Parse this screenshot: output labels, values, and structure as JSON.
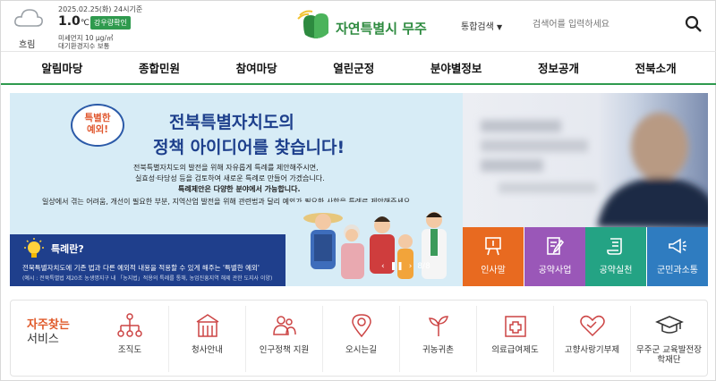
{
  "weather": {
    "icon": "cloud-icon",
    "condition": "흐림",
    "date": "2025.02.25(화) 24시기준",
    "temperature": "1.0",
    "unit": "℃",
    "region_button": "강우량확인",
    "dust_fine": "미세먼지 10 μg/㎥",
    "air_index": "대기환경지수 보통"
  },
  "logo": {
    "text": "자연특별시 무주",
    "icon": "mujun-logo-icon",
    "color": "#2d8a3f"
  },
  "search": {
    "type": "통합검색",
    "placeholder": "검색어를 입력하세요"
  },
  "nav": [
    "알림마당",
    "종합민원",
    "참여마당",
    "열린군정",
    "분야별정보",
    "정보공개",
    "전북소개"
  ],
  "banner": {
    "badge": [
      "특별한",
      "예외!"
    ],
    "title1": "전북특별자치도의",
    "title2": "정책 아이디어를 찾습니다!",
    "sub1": "전북특별자치도의 발전을 위해 자유롭게 특례를 제안해주시면,",
    "sub2": "실효성·타당성 등을 검토하여 새로운 특례로 만들어 가겠습니다.",
    "sub3": "특례제안은 다양한 분야에서 가능합니다.",
    "sub4": "일상에서 겪는 어려움, 개선이 필요한 부분, 지역산업 발전을 위해 관련법과 달리 예외가 필요한 사항을 특례로 제안해주세요.",
    "box_title": "특례란?",
    "box_desc": "전북특별자치도에 기존 법과 다른 예외적 내용을 적용할 수 있게 해주는 '특별한 예외'",
    "box_note": "(예시 : 전북특별법 제20조 농생명지구 내 「농지법」적용의 특례를 통해, 농업진흥지역 해제 관한 도지사 이양)",
    "pager": "8/8"
  },
  "tiles": [
    {
      "label": "인사말",
      "color": "#e86a20",
      "icon": "easel-icon"
    },
    {
      "label": "공약사업",
      "color": "#9a57b8",
      "icon": "document-pen-icon"
    },
    {
      "label": "공약실천",
      "color": "#24a384",
      "icon": "scroll-icon"
    },
    {
      "label": "군민과소통",
      "color": "#2f7cc0",
      "icon": "megaphone-icon"
    }
  ],
  "quick": {
    "title1": "자주찾는",
    "title2": "서비스",
    "items": [
      {
        "label": "조직도",
        "icon": "org-chart-icon"
      },
      {
        "label": "청사안내",
        "icon": "building-icon"
      },
      {
        "label": "인구정책 지원",
        "icon": "people-icon"
      },
      {
        "label": "오시는길",
        "icon": "map-pin-icon"
      },
      {
        "label": "귀농귀촌",
        "icon": "sprout-icon"
      },
      {
        "label": "의료급여제도",
        "icon": "medical-cross-icon"
      },
      {
        "label": "고향사랑기부제",
        "icon": "heart-icon"
      },
      {
        "label": "무주군 교육발전장학재단",
        "icon": "graduation-cap-icon"
      }
    ]
  }
}
